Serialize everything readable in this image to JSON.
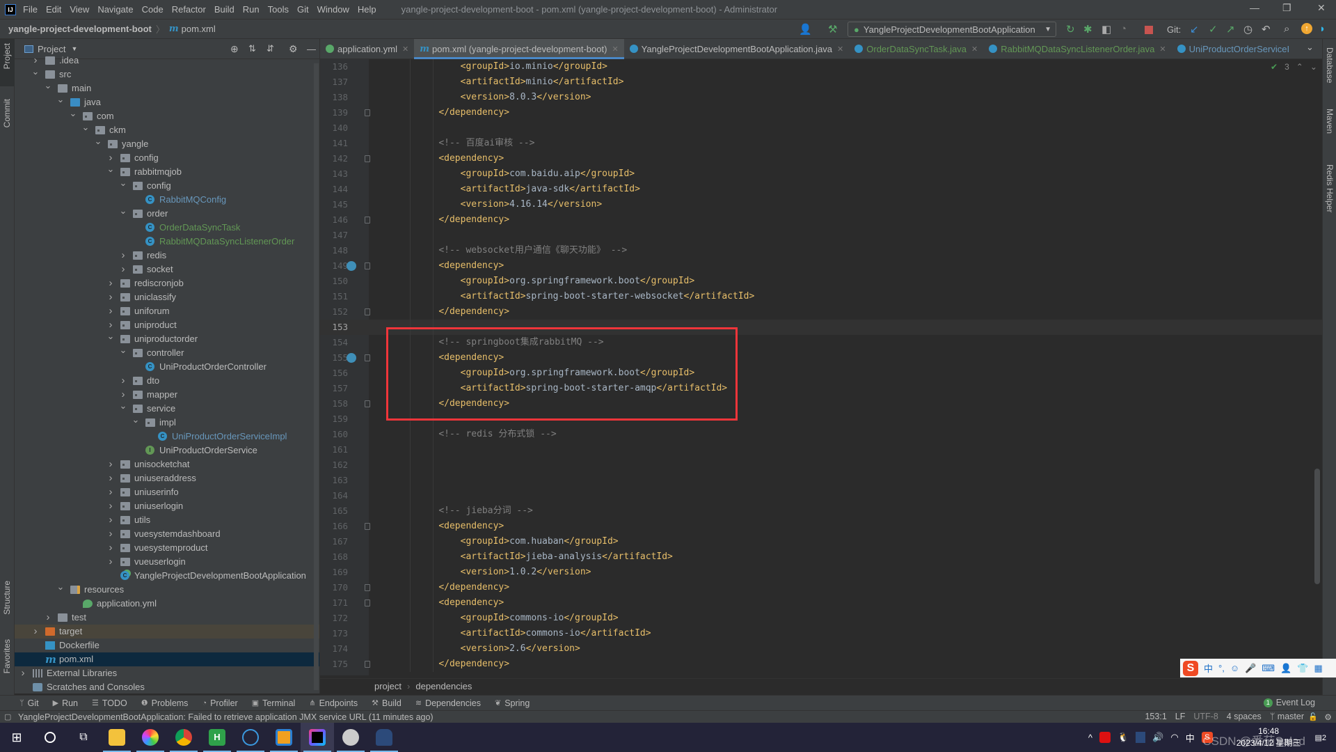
{
  "menubar": {
    "items": [
      "File",
      "Edit",
      "View",
      "Navigate",
      "Code",
      "Refactor",
      "Build",
      "Run",
      "Tools",
      "Git",
      "Window",
      "Help"
    ],
    "window_title": "yangle-project-development-boot - pom.xml (yangle-project-development-boot) - Administrator"
  },
  "navbar": {
    "project": "yangle-project-development-boot",
    "file": "pom.xml"
  },
  "toolbar": {
    "run_config": "YangleProjectDevelopmentBootApplication",
    "git_label": "Git:"
  },
  "left_stripe": [
    "Project",
    "Commit",
    "Structure",
    "Favorites"
  ],
  "right_stripe": [
    "Database",
    "Maven",
    "Redis Helper"
  ],
  "project_panel": {
    "title": "Project",
    "tree": [
      {
        "label": ".idea",
        "level": 0,
        "chev": "right",
        "icon": "folder"
      },
      {
        "label": "src",
        "level": 0,
        "chev": "down",
        "icon": "folder"
      },
      {
        "label": "main",
        "level": 1,
        "chev": "down",
        "icon": "folder"
      },
      {
        "label": "java",
        "level": 2,
        "chev": "down",
        "icon": "src"
      },
      {
        "label": "com",
        "level": 3,
        "chev": "down",
        "icon": "pkg"
      },
      {
        "label": "ckm",
        "level": 4,
        "chev": "down",
        "icon": "pkg"
      },
      {
        "label": "yangle",
        "level": 5,
        "chev": "down",
        "icon": "pkg"
      },
      {
        "label": "config",
        "level": 6,
        "chev": "right",
        "icon": "pkg"
      },
      {
        "label": "rabbitmqjob",
        "level": 6,
        "chev": "down",
        "icon": "pkg"
      },
      {
        "label": "config",
        "level": 7,
        "chev": "down",
        "icon": "pkg"
      },
      {
        "label": "RabbitMQConfig",
        "level": 8,
        "icon": "class",
        "status": "modified"
      },
      {
        "label": "order",
        "level": 7,
        "chev": "down",
        "icon": "pkg"
      },
      {
        "label": "OrderDataSyncTask",
        "level": 8,
        "icon": "class",
        "status": "added"
      },
      {
        "label": "RabbitMQDataSyncListenerOrder",
        "level": 8,
        "icon": "class",
        "status": "added"
      },
      {
        "label": "redis",
        "level": 7,
        "chev": "right",
        "icon": "pkg"
      },
      {
        "label": "socket",
        "level": 7,
        "chev": "right",
        "icon": "pkg"
      },
      {
        "label": "rediscronjob",
        "level": 6,
        "chev": "right",
        "icon": "pkg"
      },
      {
        "label": "uniclassify",
        "level": 6,
        "chev": "right",
        "icon": "pkg"
      },
      {
        "label": "uniforum",
        "level": 6,
        "chev": "right",
        "icon": "pkg"
      },
      {
        "label": "uniproduct",
        "level": 6,
        "chev": "right",
        "icon": "pkg"
      },
      {
        "label": "uniproductorder",
        "level": 6,
        "chev": "down",
        "icon": "pkg"
      },
      {
        "label": "controller",
        "level": 7,
        "chev": "down",
        "icon": "pkg"
      },
      {
        "label": "UniProductOrderController",
        "level": 8,
        "icon": "class"
      },
      {
        "label": "dto",
        "level": 7,
        "chev": "right",
        "icon": "pkg"
      },
      {
        "label": "mapper",
        "level": 7,
        "chev": "right",
        "icon": "pkg"
      },
      {
        "label": "service",
        "level": 7,
        "chev": "down",
        "icon": "pkg"
      },
      {
        "label": "impl",
        "level": 8,
        "chev": "down",
        "icon": "pkg"
      },
      {
        "label": "UniProductOrderServiceImpl",
        "level": 9,
        "icon": "class",
        "status": "modified"
      },
      {
        "label": "UniProductOrderService",
        "level": 8,
        "icon": "interface"
      },
      {
        "label": "unisocketchat",
        "level": 6,
        "chev": "right",
        "icon": "pkg"
      },
      {
        "label": "uniuseraddress",
        "level": 6,
        "chev": "right",
        "icon": "pkg"
      },
      {
        "label": "uniuserinfo",
        "level": 6,
        "chev": "right",
        "icon": "pkg"
      },
      {
        "label": "uniuserlogin",
        "level": 6,
        "chev": "right",
        "icon": "pkg"
      },
      {
        "label": "utils",
        "level": 6,
        "chev": "right",
        "icon": "pkg"
      },
      {
        "label": "vuesystemdashboard",
        "level": 6,
        "chev": "right",
        "icon": "pkg"
      },
      {
        "label": "vuesystemproduct",
        "level": 6,
        "chev": "right",
        "icon": "pkg"
      },
      {
        "label": "vueuserlogin",
        "level": 6,
        "chev": "right",
        "icon": "pkg"
      },
      {
        "label": "YangleProjectDevelopmentBootApplication",
        "level": 6,
        "icon": "springboot"
      },
      {
        "label": "resources",
        "level": 2,
        "chev": "down",
        "icon": "resources"
      },
      {
        "label": "application.yml",
        "level": 3,
        "icon": "yml"
      },
      {
        "label": "test",
        "level": 1,
        "chev": "right",
        "icon": "folder"
      },
      {
        "label": "target",
        "level": 0,
        "chev": "right",
        "icon": "excluded",
        "row": "excluded"
      },
      {
        "label": "Dockerfile",
        "level": 0,
        "icon": "docker"
      },
      {
        "label": "pom.xml",
        "level": 0,
        "icon": "maven",
        "row": "selected"
      },
      {
        "label": "External Libraries",
        "level": -1,
        "chev": "right",
        "icon": "library"
      },
      {
        "label": "Scratches and Consoles",
        "level": -1,
        "icon": "scratches"
      }
    ]
  },
  "editor": {
    "tabs": [
      {
        "label": "application.yml",
        "icon": "yml"
      },
      {
        "label": "pom.xml (yangle-project-development-boot)",
        "icon": "maven",
        "active": true
      },
      {
        "label": "YangleProjectDevelopmentBootApplication.java",
        "icon": "springboot"
      },
      {
        "label": "OrderDataSyncTask.java",
        "icon": "class",
        "status": "added"
      },
      {
        "label": "RabbitMQDataSyncListenerOrder.java",
        "icon": "class",
        "status": "added"
      },
      {
        "label": "UniProductOrderServiceI",
        "icon": "class",
        "status": "modified"
      }
    ],
    "inspection_count": "3",
    "current_line": 153,
    "lines": [
      {
        "n": 136,
        "t": "        <groupId>io.minio</groupId>"
      },
      {
        "n": 137,
        "t": "        <artifactId>minio</artifactId>"
      },
      {
        "n": 138,
        "t": "        <version>8.0.3</version>"
      },
      {
        "n": 139,
        "t": "    </dependency>",
        "fold": true
      },
      {
        "n": 140,
        "t": ""
      },
      {
        "n": 141,
        "t": "    <!-- 百度ai审核 -->"
      },
      {
        "n": 142,
        "t": "    <dependency>",
        "fold": true
      },
      {
        "n": 143,
        "t": "        <groupId>com.baidu.aip</groupId>"
      },
      {
        "n": 144,
        "t": "        <artifactId>java-sdk</artifactId>"
      },
      {
        "n": 145,
        "t": "        <version>4.16.14</version>"
      },
      {
        "n": 146,
        "t": "    </dependency>",
        "fold": true
      },
      {
        "n": 147,
        "t": ""
      },
      {
        "n": 148,
        "t": "    <!-- websocket用户通信《聊天功能》 -->"
      },
      {
        "n": 149,
        "t": "    <dependency>",
        "fold": true,
        "bean": true
      },
      {
        "n": 150,
        "t": "        <groupId>org.springframework.boot</groupId>"
      },
      {
        "n": 151,
        "t": "        <artifactId>spring-boot-starter-websocket</artifactId>"
      },
      {
        "n": 152,
        "t": "    </dependency>",
        "fold": true
      },
      {
        "n": 153,
        "t": ""
      },
      {
        "n": 154,
        "t": "    <!-- springboot集成rabbitMQ -->"
      },
      {
        "n": 155,
        "t": "    <dependency>",
        "fold": true,
        "bean": true
      },
      {
        "n": 156,
        "t": "        <groupId>org.springframework.boot</groupId>"
      },
      {
        "n": 157,
        "t": "        <artifactId>spring-boot-starter-amqp</artifactId>"
      },
      {
        "n": 158,
        "t": "    </dependency>",
        "fold": true
      },
      {
        "n": 159,
        "t": ""
      },
      {
        "n": 160,
        "t": "    <!-- redis 分布式锁 -->"
      },
      {
        "n": 161,
        "t": ""
      },
      {
        "n": 162,
        "t": ""
      },
      {
        "n": 163,
        "t": ""
      },
      {
        "n": 164,
        "t": ""
      },
      {
        "n": 165,
        "t": "    <!-- jieba分词 -->"
      },
      {
        "n": 166,
        "t": "    <dependency>",
        "fold": true
      },
      {
        "n": 167,
        "t": "        <groupId>com.huaban</groupId>"
      },
      {
        "n": 168,
        "t": "        <artifactId>jieba-analysis</artifactId>"
      },
      {
        "n": 169,
        "t": "        <version>1.0.2</version>"
      },
      {
        "n": 170,
        "t": "    </dependency>",
        "fold": true
      },
      {
        "n": 171,
        "t": "    <dependency>",
        "fold": true
      },
      {
        "n": 172,
        "t": "        <groupId>commons-io</groupId>"
      },
      {
        "n": 173,
        "t": "        <artifactId>commons-io</artifactId>"
      },
      {
        "n": 174,
        "t": "        <version>2.6</version>"
      },
      {
        "n": 175,
        "t": "    </dependency>",
        "fold": true
      }
    ],
    "breadcrumb": [
      "project",
      "dependencies"
    ]
  },
  "tool_windows": [
    "Git",
    "Run",
    "TODO",
    "Problems",
    "Profiler",
    "Terminal",
    "Endpoints",
    "Build",
    "Dependencies",
    "Spring"
  ],
  "event_log": {
    "label": "Event Log",
    "count": "1"
  },
  "status": {
    "message": "YangleProjectDevelopmentBootApplication: Failed to retrieve application JMX service URL (11 minutes ago)",
    "position": "153:1",
    "line_sep": "LF",
    "encoding": "UTF-8",
    "indent": "4 spaces",
    "branch": "master"
  },
  "ime": {
    "lang": "中"
  },
  "taskbar": {
    "time": "16:48",
    "date": "2023/4/12 星期三",
    "tray_lang": "中",
    "notifications": "2",
    "watermark": "CSDN @番茄Salad"
  },
  "colors": {
    "accent": "#4a88c7",
    "tag": "#e8bf6a",
    "comment": "#808080",
    "highlight_box": "#f0353a",
    "added": "#629755",
    "modified": "#6897bb"
  }
}
